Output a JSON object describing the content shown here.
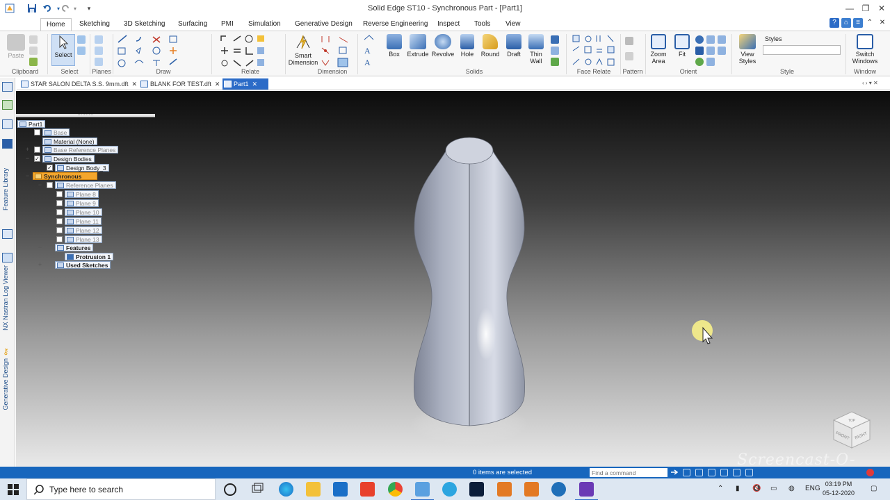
{
  "window": {
    "title": "Solid Edge ST10 - Synchronous Part - [Part1]"
  },
  "ribbon_tabs": [
    "Home",
    "Sketching",
    "3D Sketching",
    "Surfacing",
    "PMI",
    "Simulation",
    "Generative Design",
    "Reverse Engineering",
    "Inspect",
    "Tools",
    "View"
  ],
  "active_tab": "Home",
  "ribbon": {
    "clipboard": {
      "label": "Clipboard",
      "paste": "Paste"
    },
    "select": {
      "label": "Select",
      "select_button": "Select"
    },
    "planes": {
      "label": "Planes"
    },
    "draw": {
      "label": "Draw"
    },
    "relate": {
      "label": "Relate"
    },
    "dimension": {
      "label": "Dimension",
      "smart_dimension_1": "Smart",
      "smart_dimension_2": "Dimension"
    },
    "solids": {
      "label": "Solids",
      "box": "Box",
      "extrude": "Extrude",
      "revolve": "Revolve",
      "hole": "Hole",
      "round": "Round",
      "draft": "Draft",
      "thin_wall_1": "Thin",
      "thin_wall_2": "Wall"
    },
    "face_relate": {
      "label": "Face Relate"
    },
    "pattern": {
      "label": "Pattern"
    },
    "orient": {
      "label": "Orient",
      "zoom_area_1": "Zoom",
      "zoom_area_2": "Area",
      "fit": "Fit"
    },
    "style": {
      "label": "Style",
      "view_styles_1": "View",
      "view_styles_2": "Styles",
      "styles": "Styles"
    },
    "window": {
      "label": "Window",
      "switch_windows_1": "Switch",
      "switch_windows_2": "Windows"
    }
  },
  "document_tabs": [
    {
      "label": "STAR SALON DELTA S.S. 9mm.dft"
    },
    {
      "label": "BLANK FOR TEST.dft"
    },
    {
      "label": "Part1"
    }
  ],
  "left_panel_labels": {
    "feature_library": "Feature Library",
    "nx_nastran": "NX Nastran Log Viewer",
    "generative_design": "Generative Design"
  },
  "pathfinder": {
    "root": "Part1",
    "base": "Base",
    "material": "Material (None)",
    "base_reference_planes": "Base Reference Planes",
    "design_bodies": "Design Bodies",
    "design_body": "Design Body_3",
    "synchronous": "Synchronous",
    "reference_planes": "Reference Planes",
    "planes": [
      "Plane 8",
      "Plane 9",
      "Plane 10",
      "Plane 11",
      "Plane 12",
      "Plane 13"
    ],
    "features": "Features",
    "protrusion": "Protrusion 1",
    "used_sketches": "Used Sketches"
  },
  "view_cube": {
    "front": "FRONT",
    "right": "RIGHT",
    "top": "TOP"
  },
  "status_bar": {
    "selection": "0 items are selected",
    "command_placeholder": "Find a command"
  },
  "taskbar": {
    "search_placeholder": "Type here to search",
    "language": "ENG",
    "time": "03:19 PM",
    "date": "05-12-2020"
  },
  "watermark": "Screencast-O-Matic",
  "colors": {
    "accent": "#2b6bc7",
    "status_bar": "#1766bd",
    "selection": "#f3a62d"
  }
}
